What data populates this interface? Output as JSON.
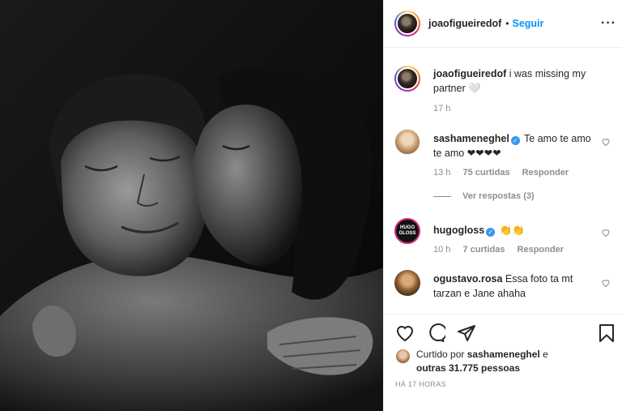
{
  "post": {
    "author": "joaofigueiredof",
    "follow_label": "Seguir",
    "more_icon": "more-options-icon",
    "photo_alt": "black-and-white photo of a couple"
  },
  "caption": {
    "user": "joaofigueiredof",
    "text": "i was missing my partner 🤍",
    "time": "17 h"
  },
  "comments": [
    {
      "user": "sashameneghel",
      "verified": true,
      "text": "Te amo te amo te amo ❤❤❤❤",
      "time": "13 h",
      "likes": "75 curtidas",
      "reply": "Responder"
    },
    {
      "user": "hugogloss",
      "verified": true,
      "text": "👏👏",
      "time": "10 h",
      "likes": "7 curtidas",
      "reply": "Responder"
    },
    {
      "user": "ogustavo.rosa",
      "verified": false,
      "text": "Essa foto ta mt tarzan e Jane ahaha"
    }
  ],
  "view_replies": "Ver respostas (3)",
  "hugogloss_logo": "HUGO GLOSS",
  "likes": {
    "prefix": "Curtido por",
    "user": "sashameneghel",
    "suffix": "e",
    "others": "outras 31.775 pessoas"
  },
  "timestamp": "HÁ 17 HORAS",
  "colors": {
    "link": "#0095f6",
    "muted": "#8e8e8e",
    "verified": "#3897f0"
  }
}
